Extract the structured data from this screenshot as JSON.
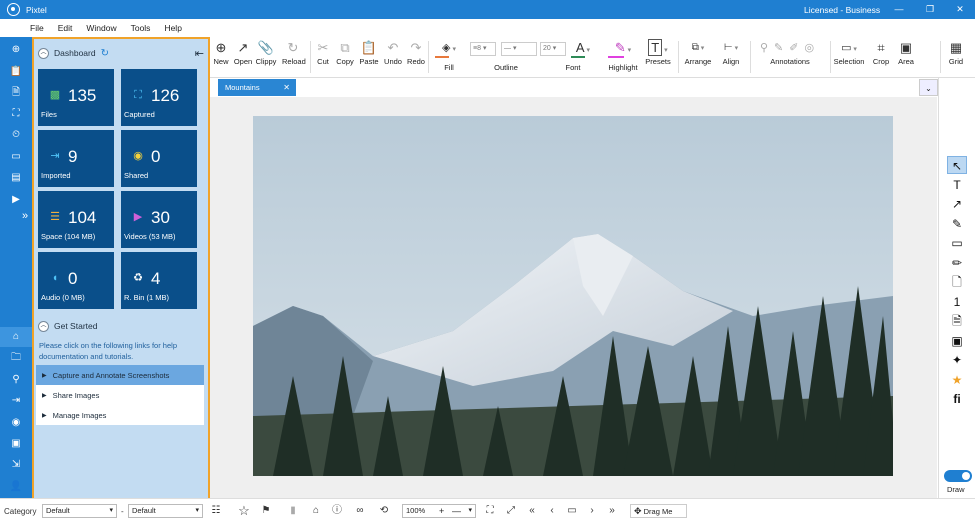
{
  "titlebar": {
    "app_title": "Pixtel",
    "license": "Licensed - Business",
    "minimize": "—",
    "restore": "❐",
    "close": "✕"
  },
  "menu": [
    "File",
    "Edit",
    "Window",
    "Tools",
    "Help"
  ],
  "dashboard": {
    "title": "Dashboard",
    "tiles": [
      {
        "label": "Files",
        "value": "135",
        "icon": "image-icon",
        "color": "#6dd36d"
      },
      {
        "label": "Captured",
        "value": "126",
        "icon": "capture-frame-icon",
        "color": "#4fc3f7"
      },
      {
        "label": "Imported",
        "value": "9",
        "icon": "import-icon",
        "color": "#4fc3f7"
      },
      {
        "label": "Shared",
        "value": "0",
        "icon": "share-eye-icon",
        "color": "#f5d33b"
      },
      {
        "label": "Space (104 MB)",
        "value": "104",
        "icon": "database-icon",
        "color": "#f0b040"
      },
      {
        "label": "Videos (53 MB)",
        "value": "30",
        "icon": "video-icon",
        "color": "#d060d8"
      },
      {
        "label": "Audio (0 MB)",
        "value": "0",
        "icon": "audio-icon",
        "color": "#4fc3f7"
      },
      {
        "label": "R. Bin (1 MB)",
        "value": "4",
        "icon": "recycle-icon",
        "color": "#ffffff"
      }
    ],
    "get_started": {
      "title": "Get Started",
      "description": "Please click on the following links for help documentation and tutorials.",
      "links": [
        "Capture and Annotate Screenshots",
        "Share Images",
        "Manage Images"
      ]
    }
  },
  "ribbon": {
    "buttons": [
      {
        "label": "New",
        "icon": "⊕"
      },
      {
        "label": "Open",
        "icon": "↗"
      },
      {
        "label": "Clippy",
        "icon": "📎"
      },
      {
        "label": "Reload",
        "icon": "↻"
      },
      {
        "label": "Cut",
        "icon": "✂"
      },
      {
        "label": "Copy",
        "icon": "⧉"
      },
      {
        "label": "Paste",
        "icon": "📋"
      },
      {
        "label": "Undo",
        "icon": "↶"
      },
      {
        "label": "Redo",
        "icon": "↷"
      }
    ],
    "fill_label": "Fill",
    "outline_label": "Outline",
    "outline_width": "8",
    "font_label": "Font",
    "font_size": "20",
    "highlight_label": "Highlight",
    "presets_label": "Presets",
    "arrange_label": "Arrange",
    "align_label": "Align",
    "annotations_label": "Annotations",
    "selection_label": "Selection",
    "crop_label": "Crop",
    "area_label": "Area",
    "grid_label": "Grid"
  },
  "tab": {
    "label": "Mountains",
    "close": "✕"
  },
  "right_tools": [
    "↖",
    "T",
    "↗",
    "✎",
    "▭",
    "✏",
    "🗋",
    "1",
    "🗎",
    "▣",
    "✦",
    "★",
    "fi"
  ],
  "draw_label": "Draw",
  "status": {
    "category_label": "Category",
    "category_value": "Default",
    "second_value": "Default",
    "dash": "-",
    "zoom": "100%",
    "drag_label": "Drag Me"
  },
  "colors": {
    "accent": "#1f7fd1",
    "tile": "#0a4f8a",
    "dash_border": "#f0a32a",
    "dash_bg": "#c3dcf2"
  }
}
